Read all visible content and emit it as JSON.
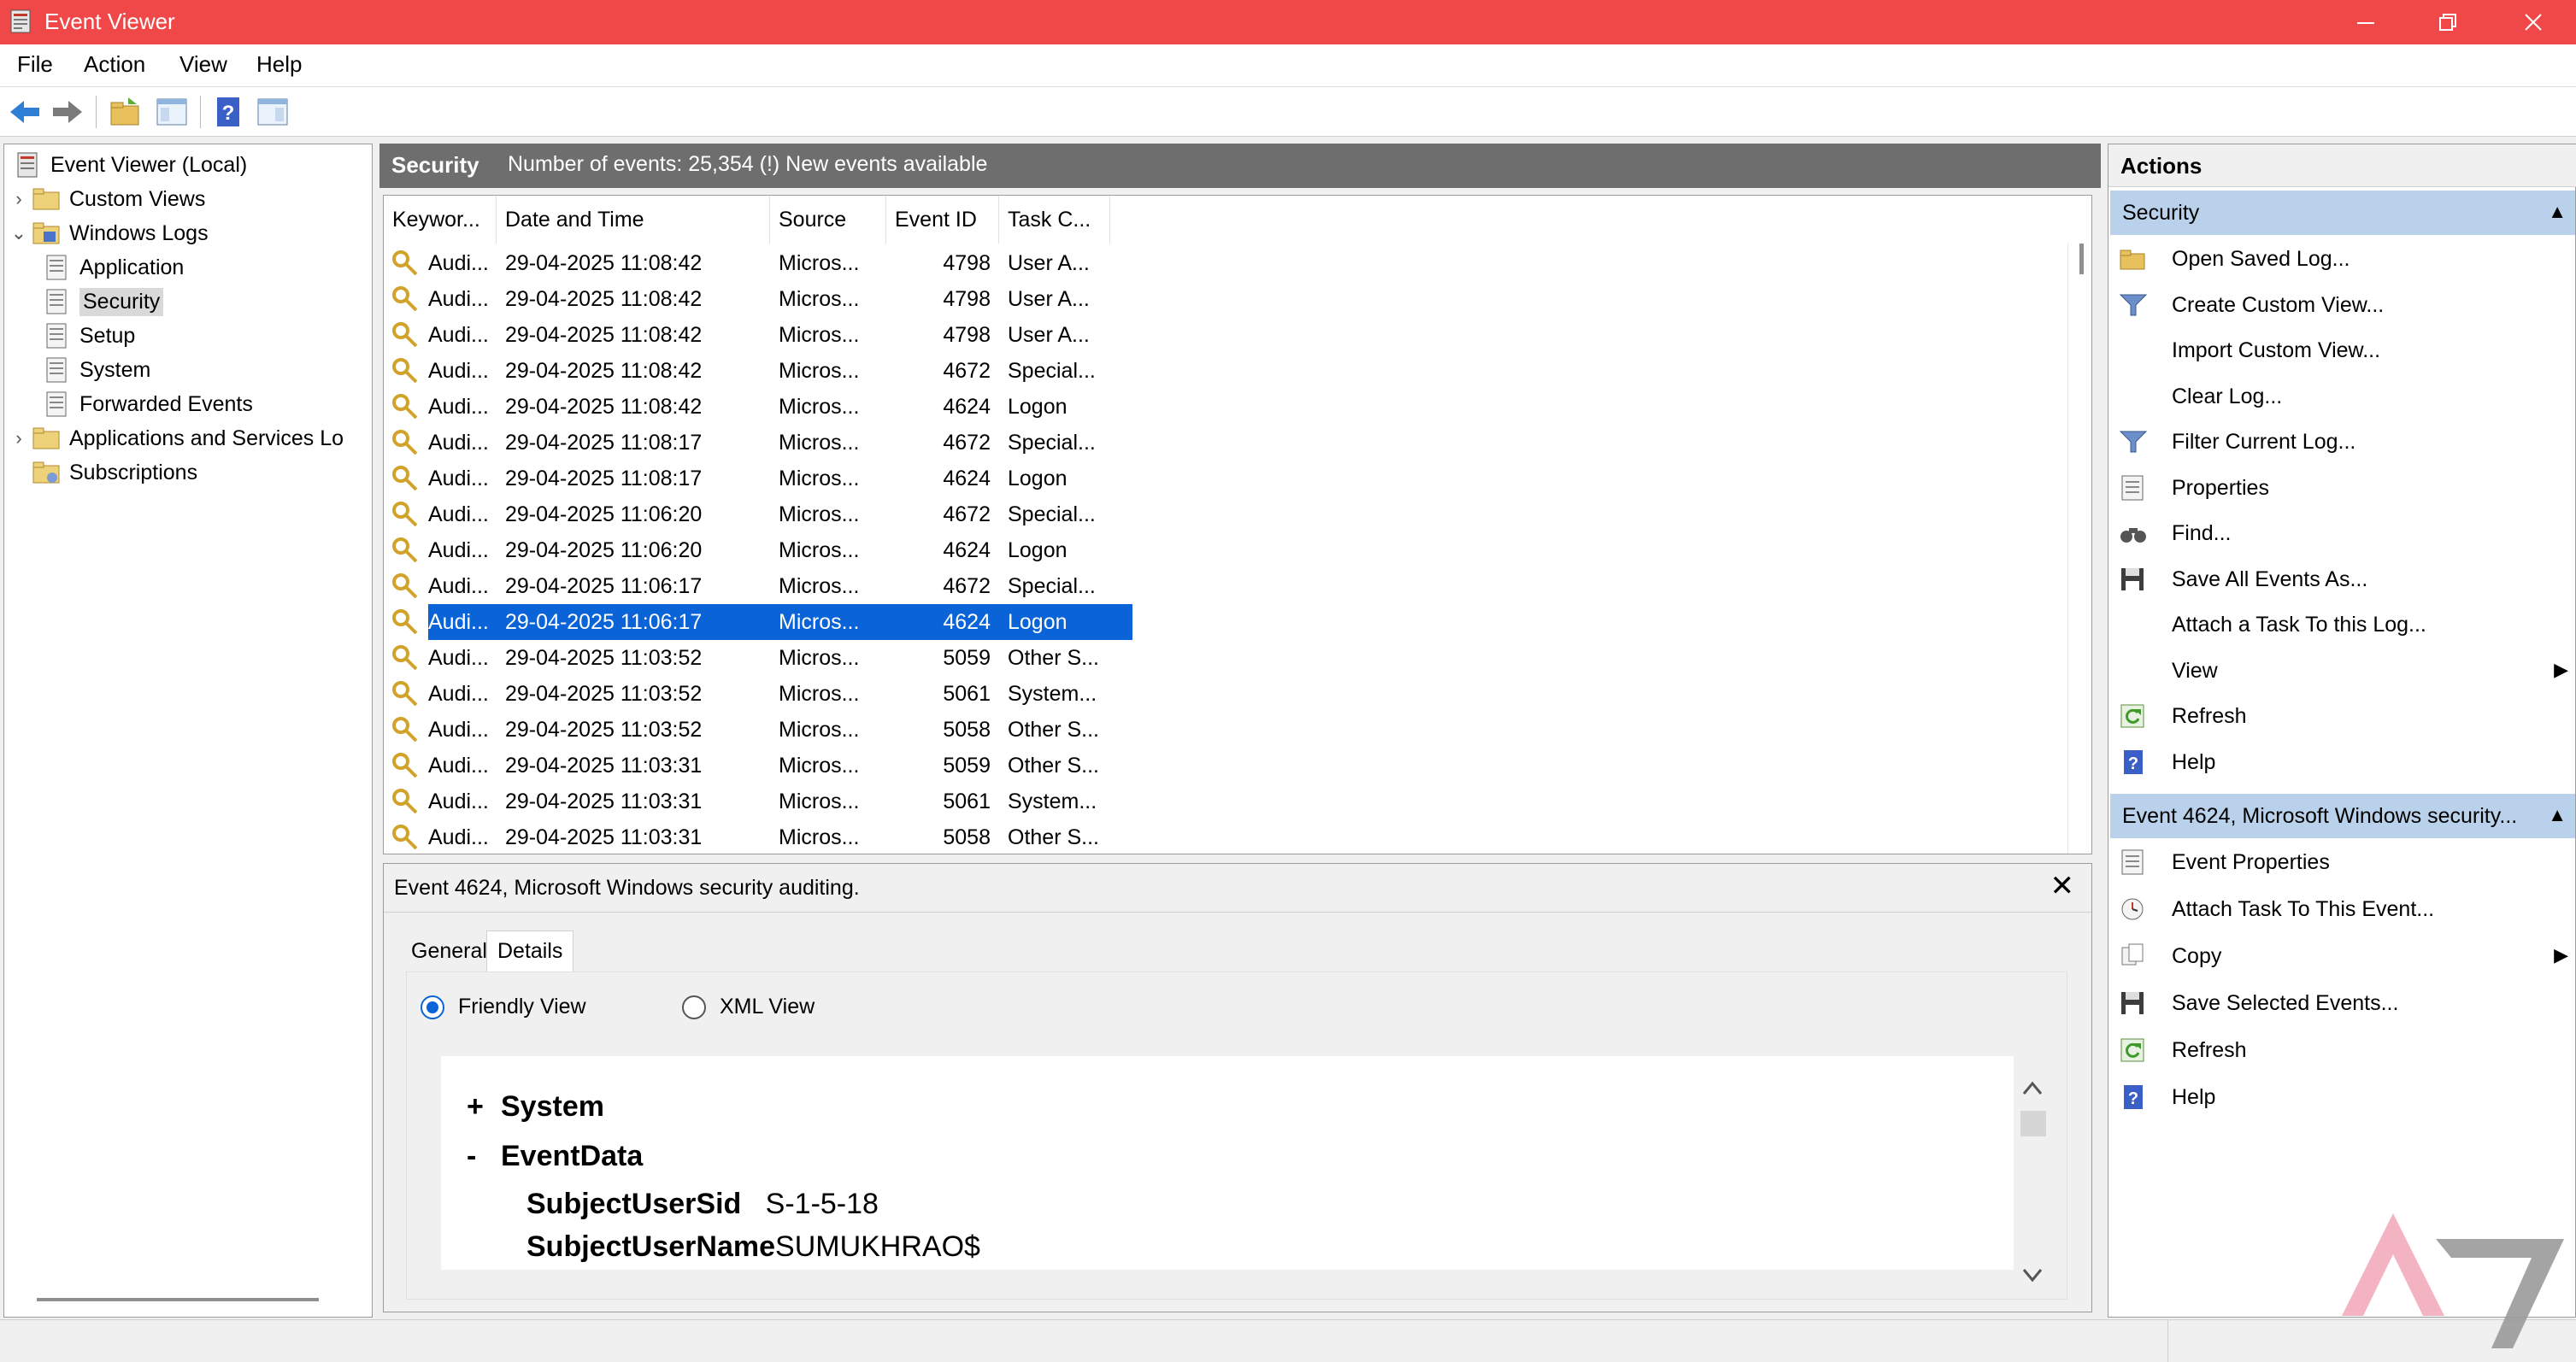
{
  "window": {
    "title": "Event Viewer",
    "titlebar_color": "#f04848",
    "minimize_icon": "minimize-icon",
    "maximize_icon": "restore-icon",
    "close_icon": "close-icon"
  },
  "menu": [
    "File",
    "Action",
    "View",
    "Help"
  ],
  "toolbar": [
    "back-arrow-icon",
    "forward-arrow-icon",
    "open-folder-icon",
    "show-hide-tree-icon",
    "help-icon",
    "show-hide-action-pane-icon"
  ],
  "tree": {
    "items": [
      {
        "label": "Event Viewer (Local)",
        "expander": "",
        "icon": "event-viewer-icon"
      },
      {
        "label": "Custom Views",
        "expander": "›",
        "icon": "folder-icon"
      },
      {
        "label": "Windows Logs",
        "expander": "⌄",
        "icon": "folder-icon"
      },
      {
        "label": "Application",
        "expander": "",
        "icon": "log-icon"
      },
      {
        "label": "Security",
        "expander": "",
        "icon": "log-icon"
      },
      {
        "label": "Setup",
        "expander": "",
        "icon": "log-icon"
      },
      {
        "label": "System",
        "expander": "",
        "icon": "log-icon"
      },
      {
        "label": "Forwarded Events",
        "expander": "",
        "icon": "log-icon"
      },
      {
        "label": "Applications and Services Lo",
        "expander": "›",
        "icon": "folder-icon"
      },
      {
        "label": "Subscriptions",
        "expander": "",
        "icon": "subscriptions-icon"
      }
    ],
    "selected": "Security"
  },
  "center": {
    "log_name": "Security",
    "log_info": "Number of events: 25,354 (!) New events available",
    "columns": [
      "Keywor...",
      "Date and Time",
      "Source",
      "Event ID",
      "Task C..."
    ],
    "rows": [
      {
        "keyword": "Audi...",
        "date": "29-04-2025 11:08:42",
        "source": "Micros...",
        "id": "4798",
        "task": "User A..."
      },
      {
        "keyword": "Audi...",
        "date": "29-04-2025 11:08:42",
        "source": "Micros...",
        "id": "4798",
        "task": "User A..."
      },
      {
        "keyword": "Audi...",
        "date": "29-04-2025 11:08:42",
        "source": "Micros...",
        "id": "4798",
        "task": "User A..."
      },
      {
        "keyword": "Audi...",
        "date": "29-04-2025 11:08:42",
        "source": "Micros...",
        "id": "4672",
        "task": "Special..."
      },
      {
        "keyword": "Audi...",
        "date": "29-04-2025 11:08:42",
        "source": "Micros...",
        "id": "4624",
        "task": "Logon"
      },
      {
        "keyword": "Audi...",
        "date": "29-04-2025 11:08:17",
        "source": "Micros...",
        "id": "4672",
        "task": "Special..."
      },
      {
        "keyword": "Audi...",
        "date": "29-04-2025 11:08:17",
        "source": "Micros...",
        "id": "4624",
        "task": "Logon"
      },
      {
        "keyword": "Audi...",
        "date": "29-04-2025 11:06:20",
        "source": "Micros...",
        "id": "4672",
        "task": "Special..."
      },
      {
        "keyword": "Audi...",
        "date": "29-04-2025 11:06:20",
        "source": "Micros...",
        "id": "4624",
        "task": "Logon"
      },
      {
        "keyword": "Audi...",
        "date": "29-04-2025 11:06:17",
        "source": "Micros...",
        "id": "4672",
        "task": "Special..."
      },
      {
        "keyword": "Audi...",
        "date": "29-04-2025 11:06:17",
        "source": "Micros...",
        "id": "4624",
        "task": "Logon"
      },
      {
        "keyword": "Audi...",
        "date": "29-04-2025 11:03:52",
        "source": "Micros...",
        "id": "5059",
        "task": "Other S..."
      },
      {
        "keyword": "Audi...",
        "date": "29-04-2025 11:03:52",
        "source": "Micros...",
        "id": "5061",
        "task": "System..."
      },
      {
        "keyword": "Audi...",
        "date": "29-04-2025 11:03:52",
        "source": "Micros...",
        "id": "5058",
        "task": "Other S..."
      },
      {
        "keyword": "Audi...",
        "date": "29-04-2025 11:03:31",
        "source": "Micros...",
        "id": "5059",
        "task": "Other S..."
      },
      {
        "keyword": "Audi...",
        "date": "29-04-2025 11:03:31",
        "source": "Micros...",
        "id": "5061",
        "task": "System..."
      },
      {
        "keyword": "Audi...",
        "date": "29-04-2025 11:03:31",
        "source": "Micros...",
        "id": "5058",
        "task": "Other S..."
      }
    ],
    "selected_row_index": 10,
    "selection_color": "#0a64d8"
  },
  "detail": {
    "title": "Event 4624, Microsoft Windows security auditing.",
    "close": "✕",
    "tabs": [
      "General",
      "Details"
    ],
    "active_tab": "Details",
    "view_options": [
      "Friendly View",
      "XML View"
    ],
    "selected_view": "Friendly View",
    "sections": [
      {
        "sign": "+",
        "name": "System"
      },
      {
        "sign": "-",
        "name": "EventData"
      }
    ],
    "fields": [
      {
        "key": "SubjectUserSid",
        "value": "S-1-5-18"
      },
      {
        "key": "SubjectUserName",
        "value": "SUMUKHRAO$"
      }
    ]
  },
  "actions": {
    "title": "Actions",
    "section1": {
      "title": "Security",
      "items": [
        {
          "label": "Open Saved Log...",
          "icon": "open-folder-icon",
          "arrow": ""
        },
        {
          "label": "Create Custom View...",
          "icon": "filter-icon",
          "arrow": ""
        },
        {
          "label": "Import Custom View...",
          "icon": "",
          "arrow": ""
        },
        {
          "label": "Clear Log...",
          "icon": "",
          "arrow": ""
        },
        {
          "label": "Filter Current Log...",
          "icon": "filter-icon",
          "arrow": ""
        },
        {
          "label": "Properties",
          "icon": "properties-icon",
          "arrow": ""
        },
        {
          "label": "Find...",
          "icon": "binoculars-icon",
          "arrow": ""
        },
        {
          "label": "Save All Events As...",
          "icon": "save-icon",
          "arrow": ""
        },
        {
          "label": "Attach a Task To this Log...",
          "icon": "",
          "arrow": ""
        },
        {
          "label": "View",
          "icon": "",
          "arrow": "▶"
        },
        {
          "label": "Refresh",
          "icon": "refresh-icon",
          "arrow": ""
        },
        {
          "label": "Help",
          "icon": "help-icon",
          "arrow": ""
        }
      ]
    },
    "section2": {
      "title": "Event 4624, Microsoft Windows security...",
      "items": [
        {
          "label": "Event Properties",
          "icon": "properties-icon",
          "arrow": ""
        },
        {
          "label": "Attach Task To This Event...",
          "icon": "task-icon",
          "arrow": ""
        },
        {
          "label": "Copy",
          "icon": "copy-icon",
          "arrow": "▶"
        },
        {
          "label": "Save Selected Events...",
          "icon": "save-icon",
          "arrow": ""
        },
        {
          "label": "Refresh",
          "icon": "refresh-icon",
          "arrow": ""
        },
        {
          "label": "Help",
          "icon": "help-icon",
          "arrow": ""
        }
      ]
    }
  },
  "watermark": "android-police-logo"
}
